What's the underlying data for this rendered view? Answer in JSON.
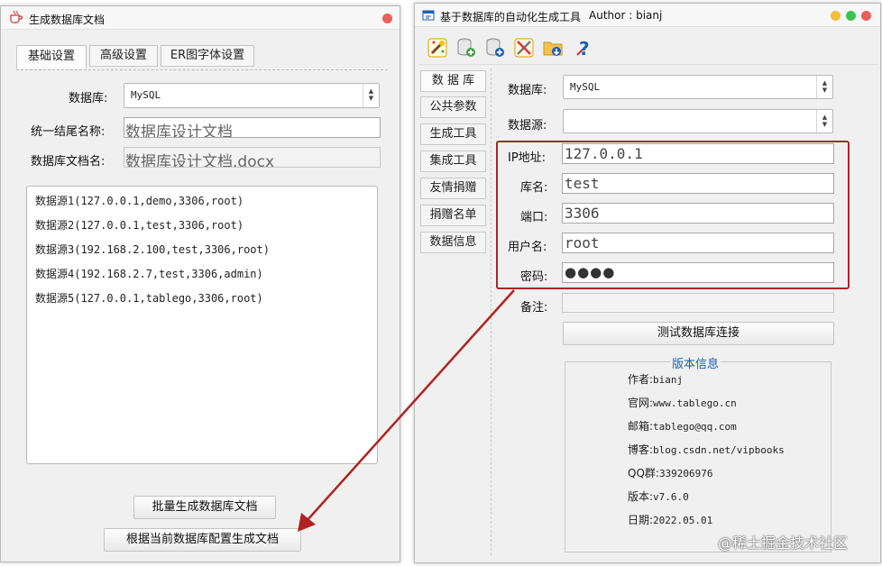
{
  "left_window": {
    "title": "生成数据库文档",
    "tabs": [
      "基础设置",
      "高级设置",
      "ER图字体设置"
    ],
    "database_label": "数据库:",
    "database_value": "MySQL",
    "suffix_label": "统一结尾名称:",
    "suffix_value": "数据库设计文档",
    "docname_label": "数据库文档名:",
    "docname_value": "数据库设计文档.docx",
    "datasources": [
      "数据源1(127.0.0.1,demo,3306,root)",
      "数据源2(127.0.0.1,test,3306,root)",
      "数据源3(192.168.2.100,test,3306,root)",
      "数据源4(192.168.2.7,test,3306,admin)",
      "数据源5(127.0.0.1,tablego,3306,root)"
    ],
    "batch_button": "批量生成数据库文档",
    "generate_button": "根据当前数据库配置生成文档"
  },
  "right_window": {
    "title": "基于数据库的自动化生成工具",
    "author": "Author : bianj",
    "toolbar_icons": [
      "wand-icon",
      "db-add-icon",
      "db-config-icon",
      "tools-icon",
      "folder-download-icon",
      "help-icon"
    ],
    "side_tabs": [
      "数 据 库",
      "公共参数",
      "生成工具",
      "集成工具",
      "友情捐赠",
      "捐赠名单",
      "数据信息"
    ],
    "db_label": "数据库:",
    "db_value": "MySQL",
    "source_label": "数据源:",
    "source_value": "",
    "ip_label": "IP地址:",
    "ip_value": "127.0.0.1",
    "dbname_label": "库名:",
    "dbname_value": "test",
    "port_label": "端口:",
    "port_value": "3306",
    "user_label": "用户名:",
    "user_value": "root",
    "pwd_label": "密码:",
    "pwd_value": "●●●●",
    "remark_label": "备注:",
    "remark_value": "",
    "test_button": "测试数据库连接",
    "version": {
      "legend": "版本信息",
      "rows": [
        {
          "label": "作者:",
          "value": "bianj"
        },
        {
          "label": "官网:",
          "value": "www.tablego.cn"
        },
        {
          "label": "邮箱:",
          "value": "tablego@qq.com"
        },
        {
          "label": "博客:",
          "value": "blog.csdn.net/vipbooks"
        },
        {
          "label": "QQ群:",
          "value": "339206976"
        },
        {
          "label": "版本:",
          "value": "v7.6.0"
        },
        {
          "label": "日期:",
          "value": "2022.05.01"
        }
      ]
    }
  },
  "watermark": "@稀土掘金技术社区",
  "colors": {
    "highlight": "#b22222",
    "link_blue": "#1a5fb4",
    "close_red": "#ec5f5a",
    "min_yellow": "#f5bd3b",
    "max_green": "#3cc450"
  }
}
